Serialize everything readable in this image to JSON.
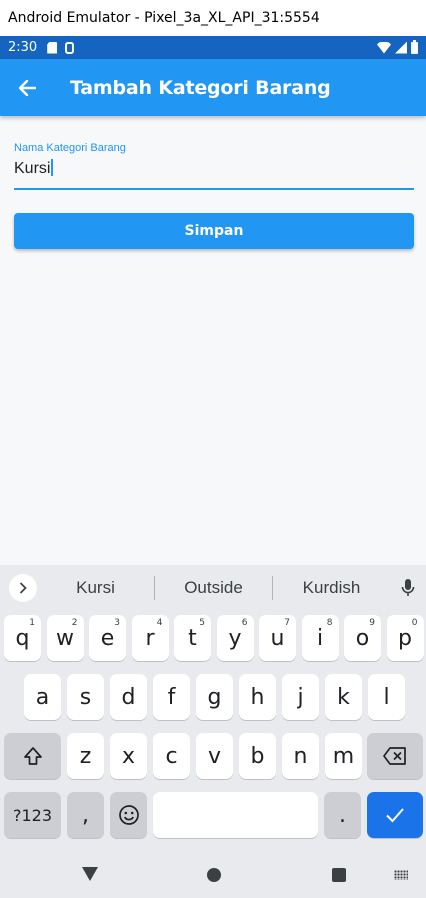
{
  "window": {
    "title": "Android Emulator - Pixel_3a_XL_API_31:5554"
  },
  "status_bar": {
    "time": "2:30"
  },
  "app_bar": {
    "title": "Tambah Kategori Barang",
    "back_icon": "arrow-left-icon"
  },
  "form": {
    "label": "Nama Kategori Barang",
    "value": "Kursi",
    "save_label": "Simpan"
  },
  "keyboard": {
    "suggestions": [
      "Kursi",
      "Outside",
      "Kurdish"
    ],
    "row1": [
      {
        "k": "q",
        "n": "1"
      },
      {
        "k": "w",
        "n": "2"
      },
      {
        "k": "e",
        "n": "3"
      },
      {
        "k": "r",
        "n": "4"
      },
      {
        "k": "t",
        "n": "5"
      },
      {
        "k": "y",
        "n": "6"
      },
      {
        "k": "u",
        "n": "7"
      },
      {
        "k": "i",
        "n": "8"
      },
      {
        "k": "o",
        "n": "9"
      },
      {
        "k": "p",
        "n": "0"
      }
    ],
    "row2": [
      "a",
      "s",
      "d",
      "f",
      "g",
      "h",
      "j",
      "k",
      "l"
    ],
    "row3": [
      "z",
      "x",
      "c",
      "v",
      "b",
      "n",
      "m"
    ],
    "symbols_label": "?123",
    "comma_label": ",",
    "period_label": "."
  },
  "colors": {
    "primary": "#2196f3",
    "status_bar": "#1565c0",
    "action_key": "#1a73e8"
  }
}
